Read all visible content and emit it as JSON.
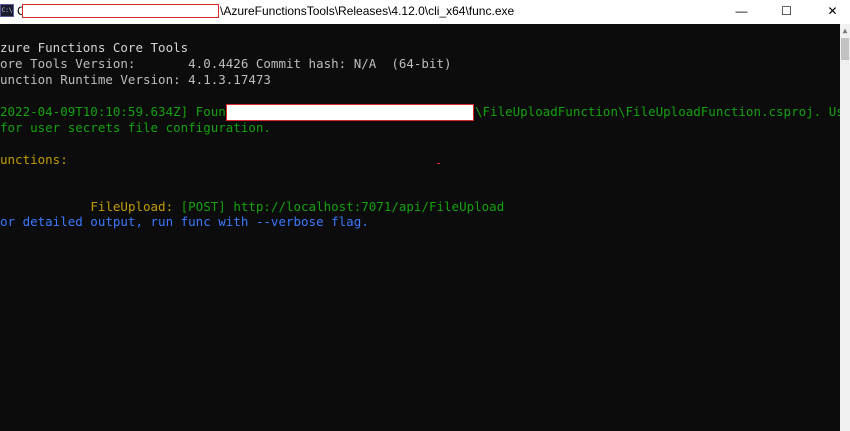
{
  "window": {
    "icon_text": "C:\\",
    "title_prefix": "C",
    "title": "\\AzureFunctionsTools\\Releases\\4.12.0\\cli_x64\\func.exe",
    "minimize_glyph": "—",
    "maximize_glyph": "☐",
    "close_glyph": "✕"
  },
  "console": {
    "header": "zure Functions Core Tools",
    "core_tools_version": "ore Tools Version:       4.0.4426 Commit hash: N/A  (64-bit)",
    "runtime_version": "unction Runtime Version: 4.1.3.17473",
    "found_prefix": "2022-04-09T10:10:59.634Z] Found ",
    "found_suffix": "\\FileUploadFunction\\FileUploadFunction.csproj. Using",
    "found_line2": "for user secrets file configuration.",
    "functions_heading": "unctions:",
    "function_name": "        FileUpload:",
    "function_url": " [POST] http://localhost:7071/api/FileUpload",
    "verbose_hint": "or detailed output, run func with --verbose flag."
  },
  "scrollbar": {
    "up_arrow": "▲"
  },
  "colors": {
    "background": "#0c0c0c",
    "text_white": "#d4d4d4",
    "text_green": "#13a10e",
    "text_yellow": "#c19c00",
    "text_blue": "#3b78ff",
    "redaction_border": "#d62b2b"
  }
}
